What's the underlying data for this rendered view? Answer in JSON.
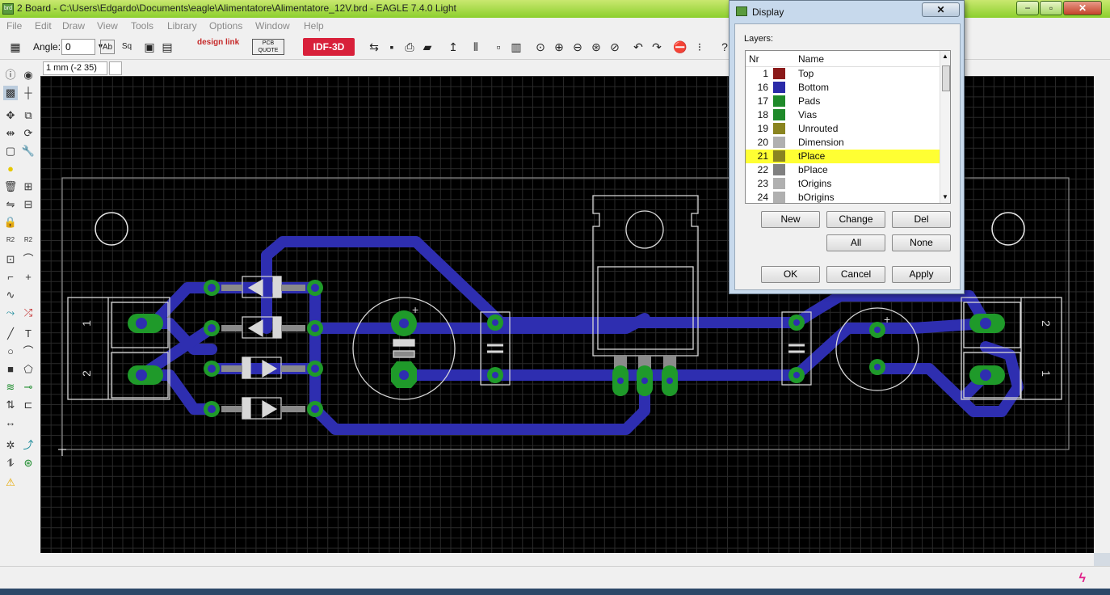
{
  "window": {
    "title": "2 Board - C:\\Users\\Edgardo\\Documents\\eagle\\Alimentatore\\Alimentatore_12V.brd - EAGLE 7.4.0 Light",
    "minimize": "−",
    "maximize": "▫",
    "close": "✕"
  },
  "menu": [
    "File",
    "Edit",
    "Draw",
    "View",
    "Tools",
    "Library",
    "Options",
    "Window",
    "Help"
  ],
  "toolbar": {
    "angle_label": "Angle:",
    "angle_value": "0",
    "idf_label": "IDF-3D",
    "designlink": "design link",
    "pcb_quote": "PCB QUOTE"
  },
  "coordinates": "1 mm (-2 35)",
  "board": {
    "connector_left_pins": [
      "1",
      "2"
    ],
    "connector_right_pins": [
      "2",
      "1"
    ]
  },
  "display_dialog": {
    "title": "Display",
    "close": "✕",
    "layers_label": "Layers:",
    "columns": {
      "nr": "Nr",
      "name": "Name"
    },
    "layers": [
      {
        "nr": "1",
        "name": "Top",
        "color": "#8b1a1a"
      },
      {
        "nr": "16",
        "name": "Bottom",
        "color": "#2a2aa8"
      },
      {
        "nr": "17",
        "name": "Pads",
        "color": "#1f8a2a"
      },
      {
        "nr": "18",
        "name": "Vias",
        "color": "#1f8a2a"
      },
      {
        "nr": "19",
        "name": "Unrouted",
        "color": "#8a8420"
      },
      {
        "nr": "20",
        "name": "Dimension",
        "color": "#b0b0b0"
      },
      {
        "nr": "21",
        "name": "tPlace",
        "color": "#8a8420"
      },
      {
        "nr": "22",
        "name": "bPlace",
        "color": "#808080"
      },
      {
        "nr": "23",
        "name": "tOrigins",
        "color": "#b0b0b0"
      },
      {
        "nr": "24",
        "name": "bOrigins",
        "color": "#b0b0b0"
      }
    ],
    "highlighted_layer": "21",
    "buttons": {
      "new": "New",
      "change": "Change",
      "del": "Del",
      "all": "All",
      "none": "None",
      "ok": "OK",
      "cancel": "Cancel",
      "apply": "Apply"
    }
  }
}
